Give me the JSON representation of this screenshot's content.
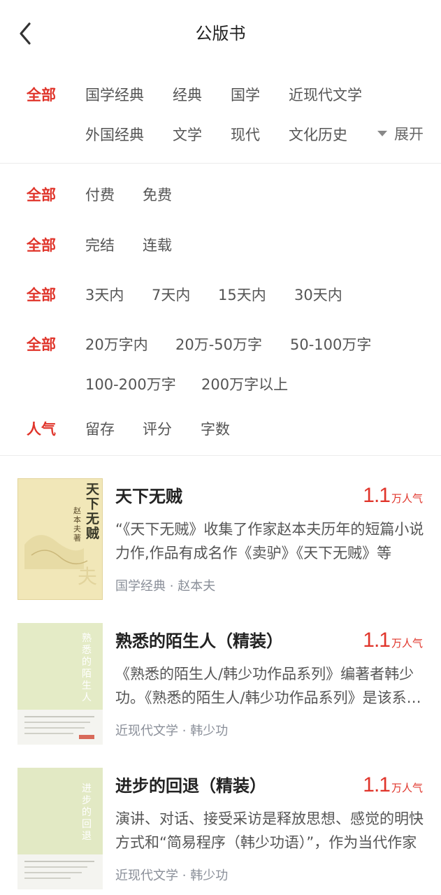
{
  "header": {
    "title": "公版书"
  },
  "filters": {
    "category": {
      "selected": "全部",
      "row1": [
        "国学经典",
        "经典",
        "国学",
        "近现代文学"
      ],
      "row2": [
        "外国经典",
        "文学",
        "现代",
        "文化历史"
      ],
      "expand_label": "展开"
    },
    "price": {
      "selected": "全部",
      "options": [
        "付费",
        "免费"
      ]
    },
    "status": {
      "selected": "全部",
      "options": [
        "完结",
        "连载"
      ]
    },
    "update": {
      "selected": "全部",
      "options": [
        "3天内",
        "7天内",
        "15天内",
        "30天内"
      ]
    },
    "length": {
      "selected": "全部",
      "row1": [
        "20万字内",
        "20万-50万字",
        "50-100万字"
      ],
      "row2": [
        "100-200万字",
        "200万字以上"
      ]
    },
    "sort": {
      "selected": "人气",
      "options": [
        "留存",
        "评分",
        "字数"
      ]
    }
  },
  "books": [
    {
      "title": "天下无贼",
      "popularity": "1.1",
      "popularity_unit": "万人气",
      "description": "“《天下无贼》收集了作家赵本夫历年的短篇小说力作,作品有成名作《卖驴》《天下无贼》等",
      "category": "国学经典",
      "author": "赵本夫",
      "cover_title": "天下无贼",
      "cover_author": "赵本夫 著"
    },
    {
      "title": "熟悉的陌生人（精装）",
      "popularity": "1.1",
      "popularity_unit": "万人气",
      "description": "《熟悉的陌生人/韩少功作品系列》编著者韩少功。《熟悉的陌生人/韩少功作品系列》是该系列之一",
      "category": "近现代文学",
      "author": "韩少功",
      "cover_title": "熟悉的陌生人"
    },
    {
      "title": "进步的回退（精装）",
      "popularity": "1.1",
      "popularity_unit": "万人气",
      "description": "演讲、对话、接受采访是释放思想、感觉的明快方式和“简易程序（韩少功语）”，作为当代作家",
      "category": "近现代文学",
      "author": "韩少功",
      "cover_title": "进步的回退"
    }
  ],
  "meta_separator": "·",
  "colors": {
    "accent": "#e0352b",
    "text": "#555555",
    "meta": "#8a8f99"
  }
}
